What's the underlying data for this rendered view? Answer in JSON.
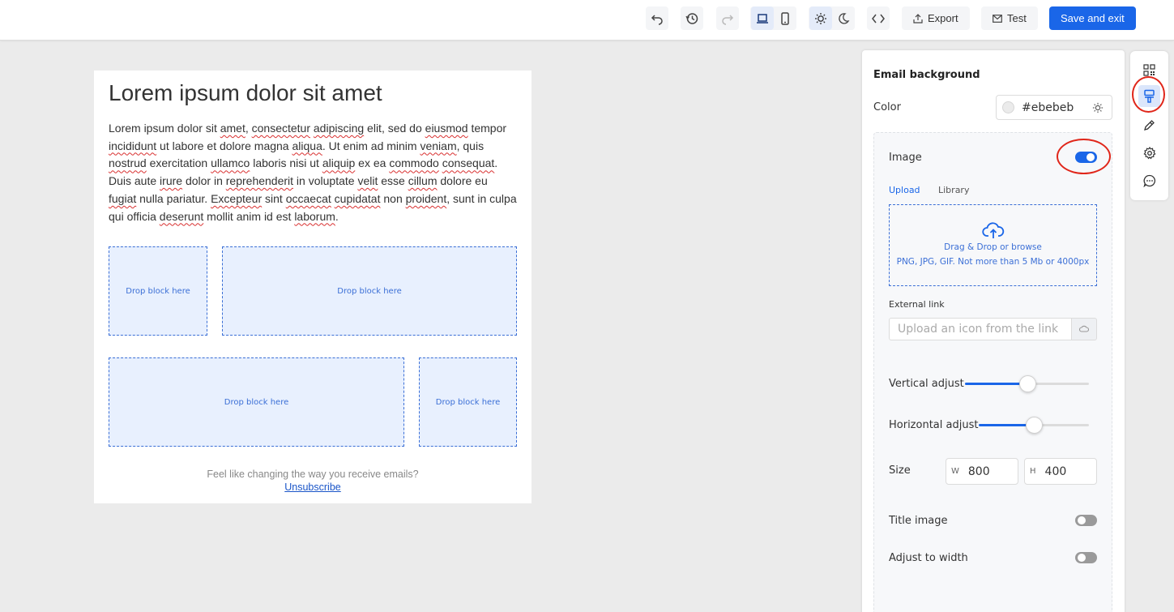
{
  "toolbar": {
    "undo_icon": "undo-icon",
    "history_icon": "history-icon",
    "redo_icon": "redo-icon",
    "desktop_icon": "laptop-icon",
    "mobile_icon": "phone-icon",
    "light_icon": "sun-icon",
    "dark_icon": "moon-icon",
    "code_icon": "code-icon",
    "export_label": "Export",
    "test_label": "Test",
    "save_label": "Save and exit",
    "accent_color": "#1a66e8"
  },
  "email": {
    "heading": "Lorem ipsum dolor sit amet",
    "paragraph": [
      {
        "t": "Lorem ipsum dolor sit ",
        "u": false
      },
      {
        "t": "amet",
        "u": true
      },
      {
        "t": ", ",
        "u": false
      },
      {
        "t": "consectetur",
        "u": true
      },
      {
        "t": " ",
        "u": false
      },
      {
        "t": "adipiscing",
        "u": true
      },
      {
        "t": " elit, sed do ",
        "u": false
      },
      {
        "t": "eiusmod",
        "u": true
      },
      {
        "t": " tempor ",
        "u": false
      },
      {
        "t": "incididunt",
        "u": true
      },
      {
        "t": " ut labore et dolore magna ",
        "u": false
      },
      {
        "t": "aliqua",
        "u": true
      },
      {
        "t": ". Ut enim ad minim ",
        "u": false
      },
      {
        "t": "veniam",
        "u": true
      },
      {
        "t": ", quis ",
        "u": false
      },
      {
        "t": "nostrud",
        "u": true
      },
      {
        "t": " exercitation ",
        "u": false
      },
      {
        "t": "ullamco",
        "u": true
      },
      {
        "t": " laboris nisi ut ",
        "u": false
      },
      {
        "t": "aliquip",
        "u": true
      },
      {
        "t": " ex ea ",
        "u": false
      },
      {
        "t": "commodo",
        "u": true
      },
      {
        "t": " ",
        "u": false
      },
      {
        "t": "consequat",
        "u": true
      },
      {
        "t": ". Duis aute ",
        "u": false
      },
      {
        "t": "irure",
        "u": true
      },
      {
        "t": " dolor in ",
        "u": false
      },
      {
        "t": "reprehenderit",
        "u": true
      },
      {
        "t": " in voluptate ",
        "u": false
      },
      {
        "t": "velit",
        "u": true
      },
      {
        "t": " esse ",
        "u": false
      },
      {
        "t": "cillum",
        "u": true
      },
      {
        "t": " dolore eu ",
        "u": false
      },
      {
        "t": "fugiat",
        "u": true
      },
      {
        "t": " nulla pariatur. ",
        "u": false
      },
      {
        "t": "Excepteur",
        "u": true
      },
      {
        "t": " sint ",
        "u": false
      },
      {
        "t": "occaecat",
        "u": true
      },
      {
        "t": " ",
        "u": false
      },
      {
        "t": "cupidatat",
        "u": true
      },
      {
        "t": " non ",
        "u": false
      },
      {
        "t": "proident",
        "u": true
      },
      {
        "t": ", sunt in culpa qui officia ",
        "u": false
      },
      {
        "t": "deserunt",
        "u": true
      },
      {
        "t": " mollit anim id est ",
        "u": false
      },
      {
        "t": "laborum",
        "u": true
      },
      {
        "t": ".",
        "u": false
      }
    ],
    "drop_blocks": [
      "Drop block here",
      "Drop block here",
      "Drop block here",
      "Drop block here"
    ],
    "footer_text": "Feel like changing the way you receive emails?",
    "unsubscribe": "Unsubscribe",
    "background_color": "#ebebeb"
  },
  "panel": {
    "title": "Email background",
    "color_label": "Color",
    "color_value": "#ebebeb",
    "image_label": "Image",
    "image_enabled": true,
    "tabs": [
      "Upload",
      "Library"
    ],
    "active_tab": "Upload",
    "upload_line1": "Drag & Drop or browse",
    "upload_line2": "PNG, JPG, GIF. Not more than 5 Mb or 4000px",
    "external_link_label": "External link",
    "external_link_placeholder": "Upload an icon from the link",
    "vertical_label": "Vertical adjust",
    "vertical_value": 0.5,
    "horizontal_label": "Horizontal adjust",
    "horizontal_value": 0.5,
    "size_label": "Size",
    "width_prefix": "W",
    "width_value": "800",
    "height_prefix": "H",
    "height_value": "400",
    "title_image_label": "Title image",
    "title_image_enabled": false,
    "adjust_width_label": "Adjust to width",
    "adjust_width_enabled": false
  },
  "rail": {
    "items": [
      "qr-code-icon",
      "paint-roller-icon",
      "pencil-icon",
      "gear-icon",
      "chat-icon"
    ],
    "active": "paint-roller-icon"
  },
  "annotation_color": "#e0261a"
}
